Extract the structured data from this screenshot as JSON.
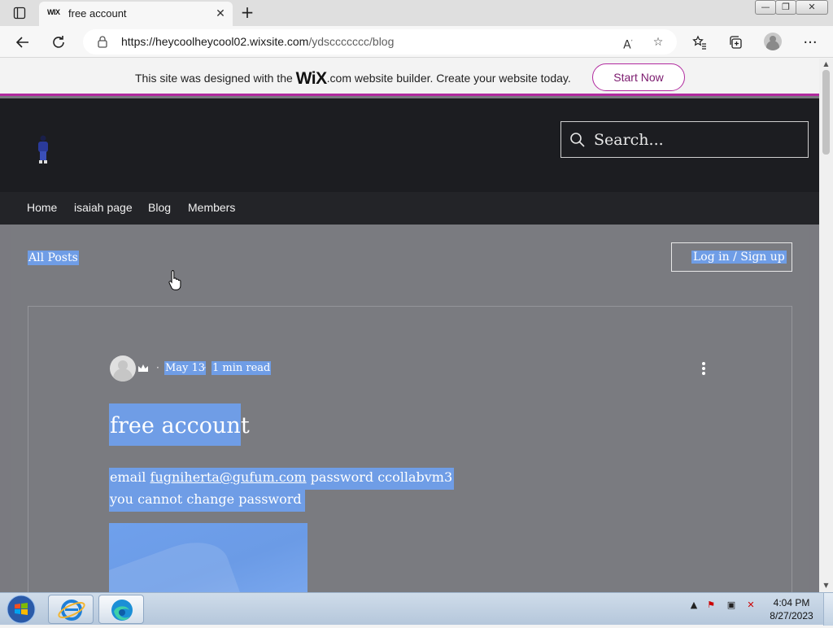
{
  "browser": {
    "tab": {
      "favicon": "WIX",
      "title": "free account",
      "close": "✕"
    },
    "new_tab": "+",
    "window_controls": {
      "minimize": "—",
      "restore": "❐",
      "close": "✕"
    },
    "url_scheme_host": "https://heycoolheycool02.wixsite.com",
    "url_path": "/ydsccccccc/blog",
    "icons": [
      "tab-actions-icon",
      "back-icon",
      "refresh-icon",
      "lock-icon",
      "read-aloud-icon",
      "add-favorite-icon",
      "favorites-icon",
      "collections-icon",
      "profile-icon",
      "more-icon"
    ]
  },
  "wix_banner": {
    "text_before": "This site was designed with the",
    "logo": "WiX",
    "logo_suffix": ".com",
    "text_after": "website builder. Create your website today.",
    "cta": "Start Now"
  },
  "site": {
    "search_placeholder": "Search...",
    "nav": [
      "Home",
      "isaiah page",
      "Blog",
      "Members"
    ]
  },
  "blog": {
    "all_posts": "All Posts",
    "login": "Log in / Sign up",
    "post": {
      "dot": "·",
      "date": "May 13",
      "read_time": "1 min read",
      "title": "free account",
      "email_label": "email",
      "email_link": "fugniherta@gufum.com",
      "password_text": "password ccollabvm3",
      "line2": "you cannot change password"
    }
  },
  "taskbar": {
    "time": "4:04 PM",
    "date": "8/27/2023"
  },
  "colors": {
    "wix_accent": "#b12a9f",
    "selection": "#6f9de6",
    "header_bg": "#1c1d21"
  }
}
